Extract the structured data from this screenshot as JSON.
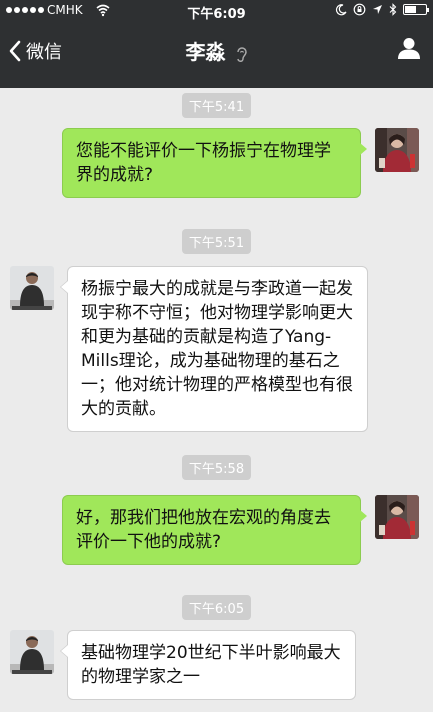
{
  "statusbar": {
    "carrier": "CMHK",
    "time": "下午6:09",
    "battery_level": 0.55
  },
  "nav": {
    "back_label": "微信",
    "title": "李淼"
  },
  "messages": [
    {
      "type": "timestamp",
      "text": "下午5:41"
    },
    {
      "type": "message",
      "sender": "me",
      "text": "您能不能评价一下杨振宁在物理学界的成就?"
    },
    {
      "type": "timestamp",
      "text": "下午5:51"
    },
    {
      "type": "message",
      "sender": "other",
      "text": "杨振宁最大的成就是与李政道一起发现宇称不守恒；他对物理学影响更大和更为基础的贡献是构造了Yang-Mills理论，成为基础物理的基石之一；他对统计物理的严格模型也有很大的贡献。"
    },
    {
      "type": "timestamp",
      "text": "下午5:58"
    },
    {
      "type": "message",
      "sender": "me",
      "text": "好，那我们把他放在宏观的角度去评价一下他的成就?"
    },
    {
      "type": "timestamp",
      "text": "下午6:05"
    },
    {
      "type": "message",
      "sender": "other",
      "text": "基础物理学20世纪下半叶影响最大的物理学家之一"
    }
  ],
  "icons": {
    "back": "chevron-left-icon",
    "earpiece": "ear-icon",
    "profile": "person-icon",
    "wifi": "wifi-icon",
    "moon": "moon-icon",
    "lock": "rotation-lock-icon",
    "location": "location-arrow-icon",
    "bluetooth": "bluetooth-icon",
    "battery": "battery-icon"
  },
  "colors": {
    "header_bg": "#2e3032",
    "chat_bg": "#ebebeb",
    "my_bubble": "#a0e75a",
    "other_bubble": "#ffffff",
    "timestamp_bg": "#cecece"
  }
}
